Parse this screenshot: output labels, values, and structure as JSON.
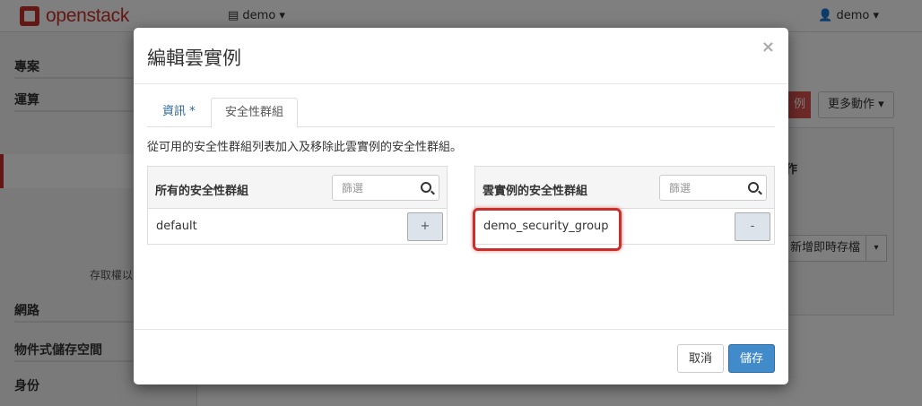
{
  "topbar": {
    "brand": "openstack",
    "project_switch": "▤ demo ▾",
    "user_menu": "👤 demo ▾"
  },
  "sidebar": {
    "items": [
      {
        "label": "專案"
      },
      {
        "label": "運算"
      },
      {
        "label": "網路"
      },
      {
        "label": "物件式儲存空間"
      },
      {
        "label": "身份"
      }
    ],
    "access_text": "存取權以"
  },
  "background": {
    "red_button": "例",
    "more_actions": "更多動作 ▾",
    "panel_action": "作",
    "snapshot_button": "新增即時存檔",
    "snapshot_caret": "▾"
  },
  "modal": {
    "title": "編輯雲實例",
    "close": "×",
    "tabs": [
      {
        "label": "資訊 *",
        "active": false
      },
      {
        "label": "安全性群組",
        "active": true
      }
    ],
    "help_text": "從可用的安全性群組列表加入及移除此雲實例的安全性群組。",
    "available": {
      "title": "所有的安全性群組",
      "filter_placeholder": "篩選",
      "items": [
        {
          "name": "default",
          "action": "+"
        }
      ]
    },
    "assigned": {
      "title": "雲實例的安全性群組",
      "filter_placeholder": "篩選",
      "items": [
        {
          "name": "demo_security_group",
          "action": "-"
        }
      ]
    },
    "cancel_label": "取消",
    "save_label": "儲存"
  },
  "colors": {
    "brand_red": "#c9302c",
    "primary_blue": "#428bca",
    "link_blue": "#2a6496"
  }
}
